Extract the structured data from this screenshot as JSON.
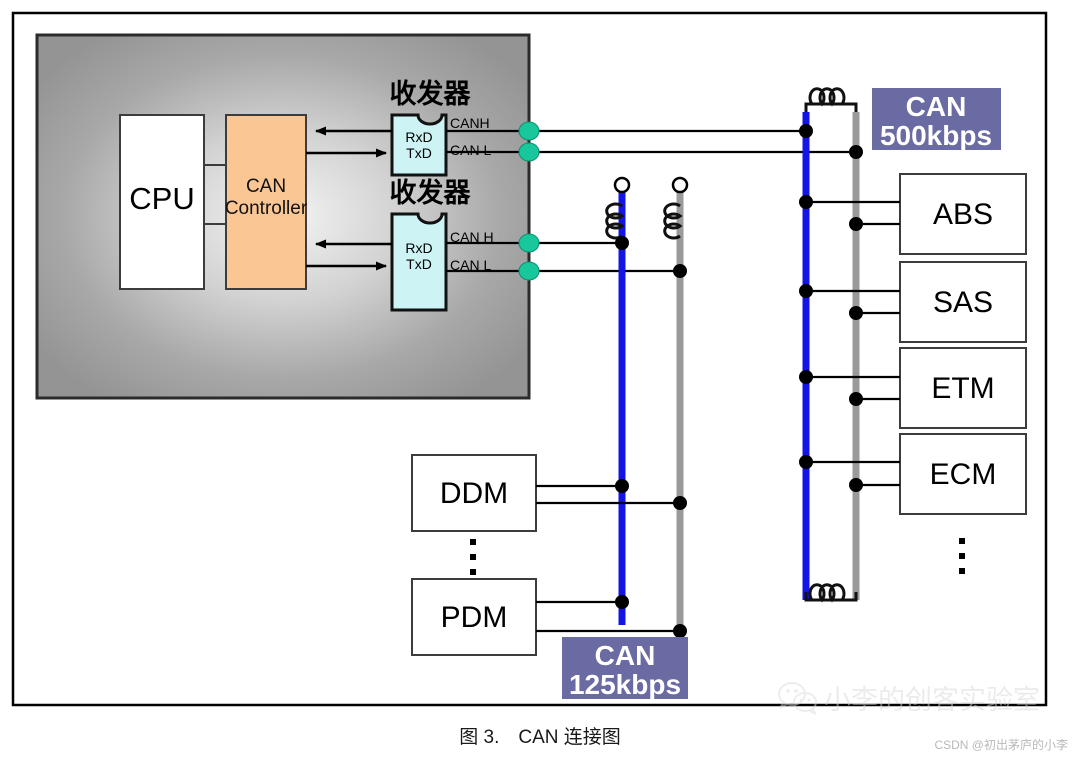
{
  "figure": {
    "caption": "图 3.　CAN 连接图",
    "credit": "CSDN @初出茅庐的小李",
    "watermark_text": "小李的创客实验室",
    "watermark_icon": "wechat-icon"
  },
  "colors": {
    "ecu_module_fill": "#9e9e9e",
    "ecu_module_center": "#f2f2f2",
    "controller_fill": "#f9c694",
    "transceiver_fill": "#cdf3f5",
    "terminal_green": "#18c79b",
    "bus_high": "#1414e6",
    "bus_low": "#9a9a9a",
    "badge_fill": "#6b6ba4",
    "box_stroke": "#3c3c3c",
    "wire": "#000000"
  },
  "ecu_module": {
    "cpu": {
      "label": "CPU"
    },
    "controller": {
      "line1": "CAN",
      "line2": "Controller"
    },
    "transceivers": [
      {
        "title": "收发器",
        "pins": {
          "rx": "RxD",
          "tx": "TxD"
        },
        "out_high": "CANH",
        "out_low": "CAN L"
      },
      {
        "title": "收发器",
        "pins": {
          "rx": "RxD",
          "tx": "TxD"
        },
        "out_high": "CAN H",
        "out_low": "CAN L"
      }
    ]
  },
  "buses": [
    {
      "id": "can-500k",
      "badge": {
        "line1": "CAN",
        "line2": "500kbps"
      },
      "high_label": "CAN H",
      "low_label": "CAN L",
      "terminations": [
        "coil-top",
        "coil-bottom"
      ],
      "nodes": [
        {
          "label": "ABS"
        },
        {
          "label": "SAS"
        },
        {
          "label": "ETM"
        },
        {
          "label": "ECM"
        }
      ],
      "continuation": "⋮"
    },
    {
      "id": "can-125k",
      "badge": {
        "line1": "CAN",
        "line2": "125kbps"
      },
      "high_label": "CAN H",
      "low_label": "CAN L",
      "terminations": [
        "coil-open-high",
        "coil-open-low"
      ],
      "nodes": [
        {
          "label": "DDM"
        },
        {
          "label": "PDM"
        }
      ],
      "continuation": "⋮"
    }
  ]
}
